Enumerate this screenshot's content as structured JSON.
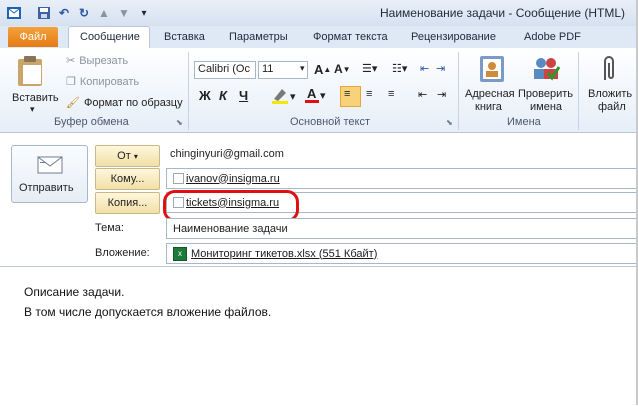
{
  "window": {
    "title": "Наименование задачи - Сообщение (HTML)"
  },
  "tabs": [
    "Файл",
    "Сообщение",
    "Вставка",
    "Параметры",
    "Формат текста",
    "Рецензирование",
    "Adobe PDF"
  ],
  "ribbon": {
    "clipboard": {
      "paste": "Вставить",
      "cut": "Вырезать",
      "copy": "Копировать",
      "format_painter": "Формат по образцу",
      "group_label": "Буфер обмена"
    },
    "basic_text": {
      "font_name": "Calibri (Ос",
      "font_size": "11",
      "bold": "Ж",
      "italic": "К",
      "underline": "Ч",
      "group_label": "Основной текст"
    },
    "names": {
      "address_book_1": "Адресная",
      "address_book_2": "книга",
      "check_names_1": "Проверить",
      "check_names_2": "имена",
      "group_label": "Имена"
    },
    "attach": {
      "label_1": "Вложить",
      "label_2": "файл"
    }
  },
  "compose": {
    "send": "Отправить",
    "from_button": "От",
    "from_value": "chinginyuri@gmail.com",
    "to_button": "Кому...",
    "to_value": "ivanov@insigma.ru",
    "cc_button": "Копия...",
    "cc_value": "tickets@insigma.ru",
    "subject_label": "Тема:",
    "subject_value": "Наименование задачи",
    "attachment_label": "Вложение:",
    "attachment_value": "Мониторинг тикетов.xlsx (551 Кбайт)"
  },
  "body": {
    "line1": "Описание задачи.",
    "line2": "В том числе допускается вложение файлов."
  },
  "colors": {
    "highlight": "#e01010",
    "file_tab": "#e57b14"
  }
}
